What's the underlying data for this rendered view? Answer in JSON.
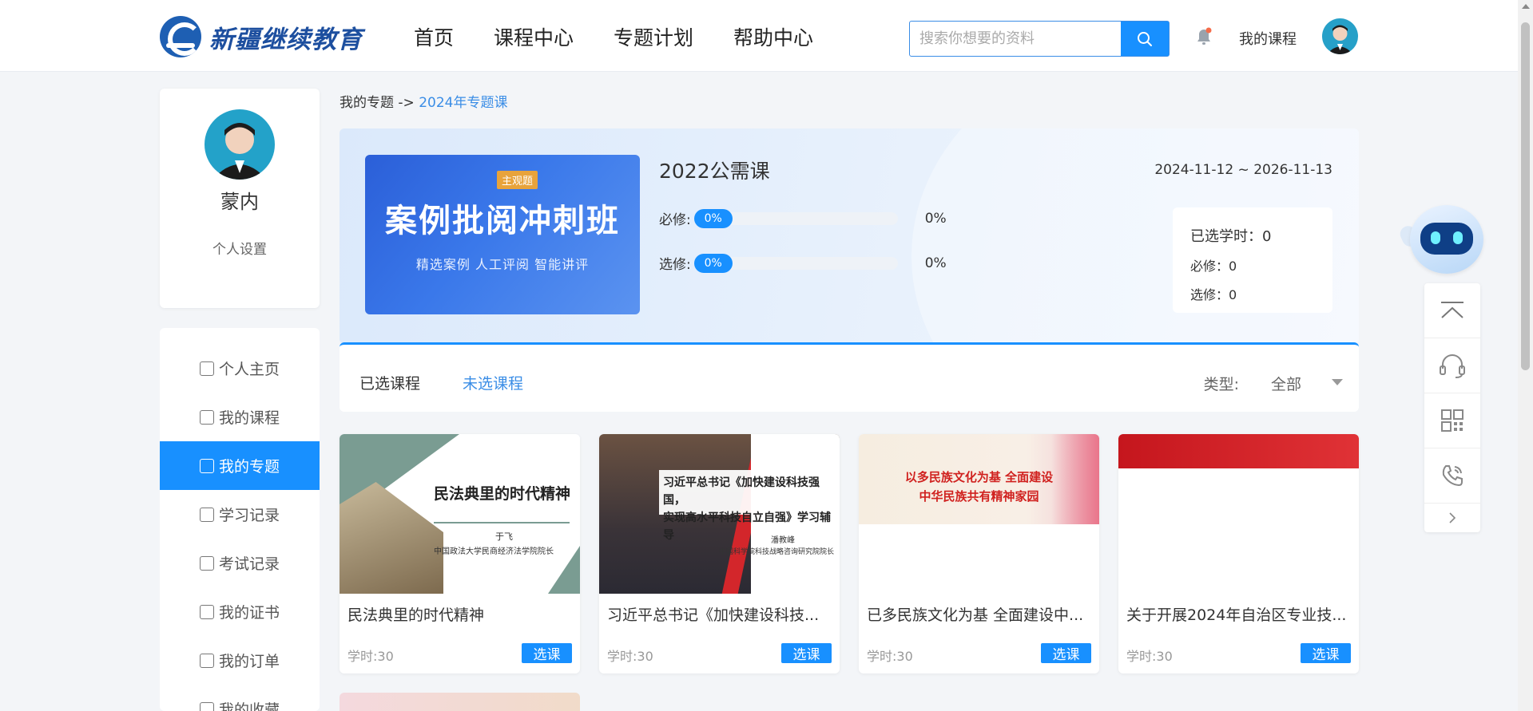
{
  "header": {
    "logo_text": "新疆继续教育",
    "nav": [
      "首页",
      "课程中心",
      "专题计划",
      "帮助中心"
    ],
    "search_placeholder": "搜索你想要的资料",
    "my_courses": "我的课程"
  },
  "profile": {
    "name": "蒙内",
    "settings": "个人设置"
  },
  "sidebar": {
    "items": [
      {
        "label": "个人主页",
        "icon": "home-icon"
      },
      {
        "label": "我的课程",
        "icon": "book-icon"
      },
      {
        "label": "我的专题",
        "icon": "topic-icon",
        "active": true
      },
      {
        "label": "学习记录",
        "icon": "record-icon"
      },
      {
        "label": "考试记录",
        "icon": "exam-icon"
      },
      {
        "label": "我的证书",
        "icon": "certificate-icon"
      },
      {
        "label": "我的订单",
        "icon": "order-icon"
      },
      {
        "label": "我的收藏",
        "icon": "star-icon"
      }
    ]
  },
  "breadcrumb": {
    "parent": "我的专题 ->",
    "current": "2024年专题课"
  },
  "banner": {
    "image_tag": "主观题",
    "image_title": "案例批阅冲刺班",
    "image_subtitle": "精选案例   人工评阅   智能讲评",
    "title": "2022公需课",
    "date_range": "2024-11-12 ~ 2026-11-13",
    "required": {
      "label": "必修:",
      "pill": "0%",
      "percent_text": "0%",
      "value": 0
    },
    "elective": {
      "label": "选修:",
      "pill": "0%",
      "percent_text": "0%",
      "value": 0
    },
    "stats": {
      "selected_hours": "已选学时：0",
      "required": "必修：0",
      "elective": "选修：0"
    }
  },
  "tabs": {
    "selected": "已选课程",
    "unselected": "未选课程",
    "type_label": "类型:",
    "type_value": "全部"
  },
  "courses": [
    {
      "title": "民法典里的时代精神",
      "hours": "学时:30",
      "button": "选课",
      "thumb_title": "民法典里的时代精神",
      "thumb_author": "于飞",
      "thumb_org": "中国政法大学民商经济法学院院长"
    },
    {
      "title": "习近平总书记《加快建设科技...",
      "hours": "学时:30",
      "button": "选课",
      "thumb_title_1": "习近平总书记《加快建设科技强国，",
      "thumb_title_2": "实现高水平科技自立自强》学习辅导",
      "thumb_author": "潘教峰",
      "thumb_org": "中国科学院科技战略咨询研究院院长"
    },
    {
      "title": "已多民族文化为基 全面建设中...",
      "hours": "学时:30",
      "button": "选课",
      "thumb_title_1": "以多民族文化为基  全面建设",
      "thumb_title_2": "中华民族共有精神家园"
    },
    {
      "title": "关于开展2024年自治区专业技...",
      "hours": "学时:30",
      "button": "选课"
    }
  ]
}
